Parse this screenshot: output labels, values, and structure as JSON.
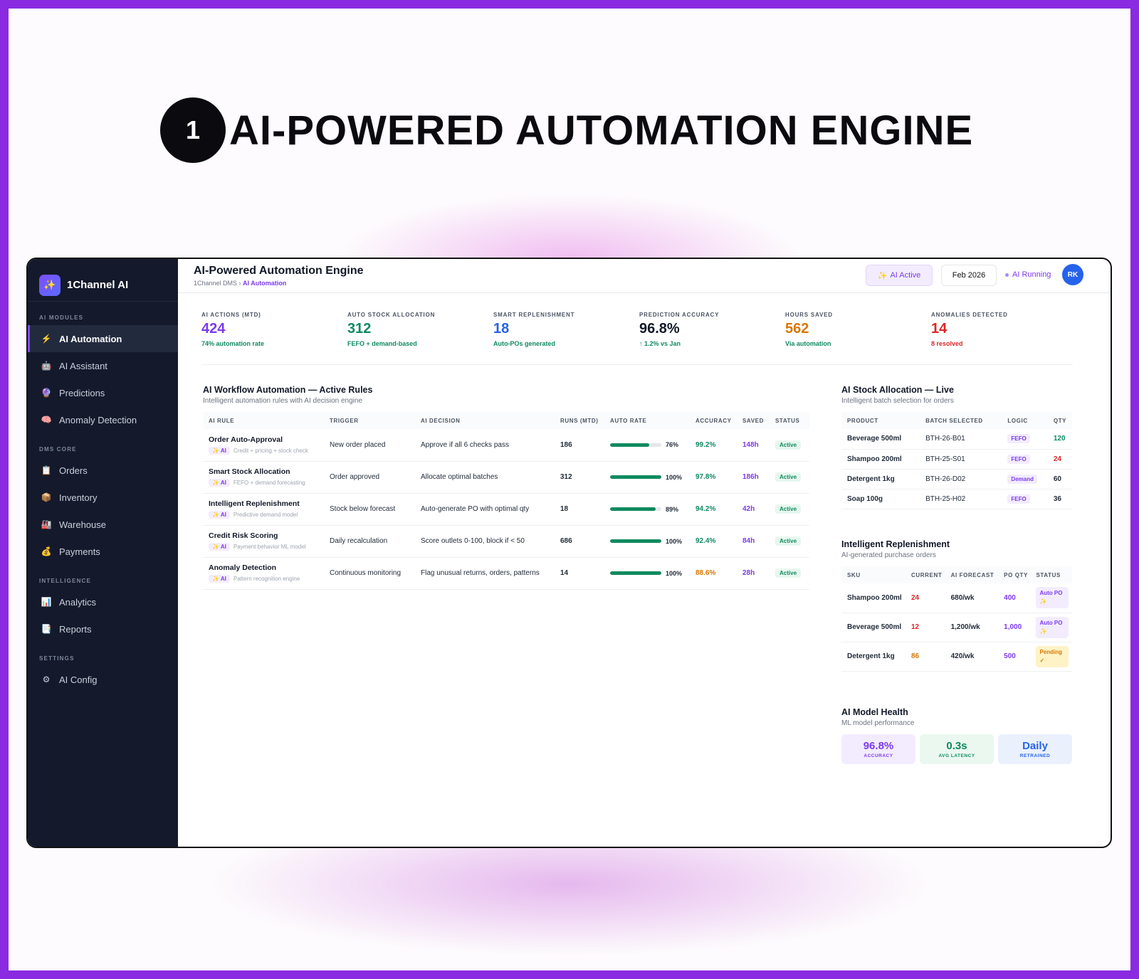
{
  "hero": {
    "number": "1",
    "title": "AI-POWERED AUTOMATION ENGINE"
  },
  "sidebar": {
    "brand": "1Channel AI",
    "sections": [
      {
        "label": "AI MODULES",
        "items": [
          {
            "label": "AI Automation",
            "icon": "⚡",
            "active": true
          },
          {
            "label": "AI Assistant",
            "icon": "🤖"
          },
          {
            "label": "Predictions",
            "icon": "🔮"
          },
          {
            "label": "Anomaly Detection",
            "icon": "🧠"
          }
        ]
      },
      {
        "label": "DMS CORE",
        "items": [
          {
            "label": "Orders",
            "icon": "📋"
          },
          {
            "label": "Inventory",
            "icon": "📦"
          },
          {
            "label": "Warehouse",
            "icon": "🏭"
          },
          {
            "label": "Payments",
            "icon": "💰"
          }
        ]
      },
      {
        "label": "INTELLIGENCE",
        "items": [
          {
            "label": "Analytics",
            "icon": "📊"
          },
          {
            "label": "Reports",
            "icon": "📑"
          }
        ]
      },
      {
        "label": "SETTINGS",
        "items": [
          {
            "label": "AI Config",
            "icon": "⚙"
          }
        ]
      }
    ]
  },
  "header": {
    "title": "AI-Powered Automation Engine",
    "crumb_root": "1Channel DMS ›",
    "crumb_current": "AI Automation",
    "ai_active": "AI Active",
    "date": "Feb 2026",
    "running": "AI Running",
    "avatar": "RK"
  },
  "kpis": [
    {
      "label": "AI ACTIONS (MTD)",
      "value": "424",
      "sub": "74% automation rate",
      "color": "#7c3aed",
      "sub_color": "#0f8a5f"
    },
    {
      "label": "AUTO STOCK ALLOCATION",
      "value": "312",
      "sub": "FEFO + demand-based",
      "color": "#0f8a5f",
      "sub_color": "#0f8a5f"
    },
    {
      "label": "SMART REPLENISHMENT",
      "value": "18",
      "sub": "Auto-POs generated",
      "color": "#2563eb",
      "sub_color": "#0f8a5f"
    },
    {
      "label": "PREDICTION ACCURACY",
      "value": "96.8%",
      "sub": "↑ 1.2% vs Jan",
      "color": "#111827",
      "sub_color": "#0f8a5f"
    },
    {
      "label": "HOURS SAVED",
      "value": "562",
      "sub": "Via automation",
      "color": "#d97706",
      "sub_color": "#0f8a5f"
    },
    {
      "label": "ANOMALIES DETECTED",
      "value": "14",
      "sub": "8 resolved",
      "color": "#dc2626",
      "sub_color": "#dc2626"
    }
  ],
  "rules": {
    "title": "AI Workflow Automation — Active Rules",
    "subtitle": "Intelligent automation rules with AI decision engine",
    "columns": [
      "AI RULE",
      "TRIGGER",
      "AI DECISION",
      "RUNS (MTD)",
      "AUTO RATE",
      "ACCURACY",
      "SAVED",
      "STATUS"
    ],
    "rows": [
      {
        "name": "Order Auto-Approval",
        "chip": "✨ AI",
        "desc": "Credit + pricing + stock check",
        "trigger": "New order placed",
        "decision": "Approve if all 6 checks pass",
        "runs": "186",
        "rate": 76,
        "rate_label": "76%",
        "accuracy": "99.2%",
        "acc_class": "green",
        "saved": "148h",
        "status": "Active"
      },
      {
        "name": "Smart Stock Allocation",
        "chip": "✨ AI",
        "desc": "FEFO + demand forecasting",
        "trigger": "Order approved",
        "decision": "Allocate optimal batches",
        "runs": "312",
        "rate": 100,
        "rate_label": "100%",
        "accuracy": "97.8%",
        "acc_class": "green",
        "saved": "186h",
        "status": "Active"
      },
      {
        "name": "Intelligent Replenishment",
        "chip": "✨ AI",
        "desc": "Predictive demand model",
        "trigger": "Stock below forecast",
        "decision": "Auto-generate PO with optimal qty",
        "runs": "18",
        "rate": 89,
        "rate_label": "89%",
        "accuracy": "94.2%",
        "acc_class": "green",
        "saved": "42h",
        "status": "Active"
      },
      {
        "name": "Credit Risk Scoring",
        "chip": "✨ AI",
        "desc": "Payment behavior ML model",
        "trigger": "Daily recalculation",
        "decision": "Score outlets 0-100, block if < 50",
        "runs": "686",
        "rate": 100,
        "rate_label": "100%",
        "accuracy": "92.4%",
        "acc_class": "green",
        "saved": "84h",
        "status": "Active"
      },
      {
        "name": "Anomaly Detection",
        "chip": "✨ AI",
        "desc": "Pattern recognition engine",
        "trigger": "Continuous monitoring",
        "decision": "Flag unusual returns, orders, patterns",
        "runs": "14",
        "rate": 100,
        "rate_label": "100%",
        "accuracy": "88.6%",
        "acc_class": "orange",
        "saved": "28h",
        "status": "Active"
      }
    ]
  },
  "allocation": {
    "title": "AI Stock Allocation — Live",
    "subtitle": "Intelligent batch selection for orders",
    "columns": [
      "PRODUCT",
      "BATCH SELECTED",
      "LOGIC",
      "QTY"
    ],
    "rows": [
      {
        "product": "Beverage 500ml",
        "batch": "BTH-26-B01",
        "logic": "FEFO",
        "qty": "120",
        "qty_class": "green"
      },
      {
        "product": "Shampoo 200ml",
        "batch": "BTH-25-S01",
        "logic": "FEFO",
        "qty": "24",
        "qty_class": "red"
      },
      {
        "product": "Detergent 1kg",
        "batch": "BTH-26-D02",
        "logic": "Demand",
        "qty": "60",
        "qty_class": ""
      },
      {
        "product": "Soap 100g",
        "batch": "BTH-25-H02",
        "logic": "FEFO",
        "qty": "36",
        "qty_class": ""
      }
    ]
  },
  "replenishment": {
    "title": "Intelligent Replenishment",
    "subtitle": "AI-generated purchase orders",
    "columns": [
      "SKU",
      "CURRENT",
      "AI FORECAST",
      "PO QTY",
      "STATUS"
    ],
    "rows": [
      {
        "sku": "Shampoo 200ml",
        "current": "24",
        "cur_class": "red",
        "forecast": "680/wk",
        "po": "400",
        "status": "Auto PO ✨",
        "st": "auto"
      },
      {
        "sku": "Beverage 500ml",
        "current": "12",
        "cur_class": "red",
        "forecast": "1,200/wk",
        "po": "1,000",
        "status": "Auto PO ✨",
        "st": "auto"
      },
      {
        "sku": "Detergent 1kg",
        "current": "86",
        "cur_class": "orange",
        "forecast": "420/wk",
        "po": "500",
        "status": "Pending ✓",
        "st": "pend"
      }
    ]
  },
  "health": {
    "title": "AI Model Health",
    "subtitle": "ML model performance",
    "cards": [
      {
        "value": "96.8%",
        "label": "ACCURACY",
        "color": "#7c3aed",
        "bg": "#f3ecff"
      },
      {
        "value": "0.3s",
        "label": "AVG LATENCY",
        "color": "#0f8a5f",
        "bg": "#eaf8f0"
      },
      {
        "value": "Daily",
        "label": "RETRAINED",
        "color": "#2563eb",
        "bg": "#eaf1fd"
      }
    ]
  }
}
